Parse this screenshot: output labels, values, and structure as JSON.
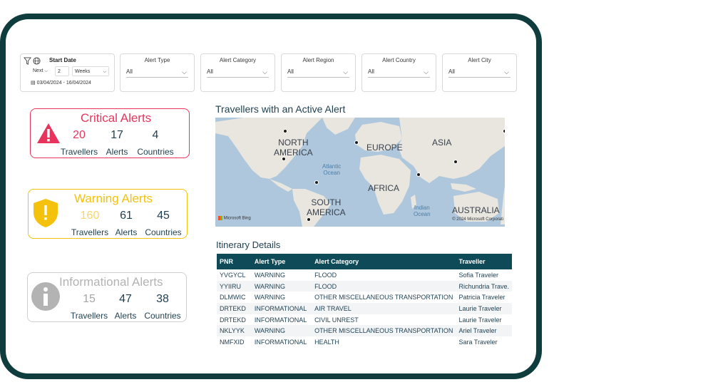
{
  "filters": {
    "start_date": {
      "title": "Start Date",
      "period": "Next",
      "count": "2",
      "unit": "Weeks",
      "range": "03/04/2024 - 16/04/2024"
    },
    "items": [
      {
        "title": "Alert Type",
        "value": "All"
      },
      {
        "title": "Alert Category",
        "value": "All"
      },
      {
        "title": "Alert Region",
        "value": "All"
      },
      {
        "title": "Alert Country",
        "value": "All"
      },
      {
        "title": "Alert City",
        "value": "All"
      }
    ]
  },
  "critical": {
    "title": "Critical Alerts",
    "travellers": "20",
    "alerts": "17",
    "countries": "4",
    "color": "#e8345c"
  },
  "warning": {
    "title": "Warning Alerts",
    "travellers": "160",
    "alerts": "61",
    "countries": "45",
    "color": "#f4c20d"
  },
  "informational": {
    "title": "Informational Alerts",
    "travellers": "15",
    "alerts": "47",
    "countries": "38",
    "color": "#b3b3b3"
  },
  "labels": {
    "travellers": "Travellers",
    "alerts": "Alerts",
    "countries": "Countries"
  },
  "map": {
    "title": "Travellers with an Active Alert",
    "regions": {
      "north_america_1": "NORTH",
      "north_america_2": "AMERICA",
      "europe": "EUROPE",
      "asia": "ASIA",
      "africa": "AFRICA",
      "south_america_1": "SOUTH",
      "south_america_2": "AMERICA",
      "australia": "AUSTRALIA"
    },
    "oceans": {
      "atlantic_1": "Atlantic",
      "atlantic_2": "Ocean",
      "indian_1": "Indian",
      "indian_2": "Ocean"
    },
    "attribution_left": "Microsoft Bing",
    "attribution_right": "© 2024 Microsoft Corporati"
  },
  "itinerary": {
    "title": "Itinerary Details",
    "columns": [
      "PNR",
      "Alert Type",
      "Alert Category",
      "Traveller"
    ],
    "rows": [
      [
        "YVGYCL",
        "WARNING",
        "FLOOD",
        "Sofia Traveler"
      ],
      [
        "YYIIRU",
        "WARNING",
        "FLOOD",
        "Richundria Trave."
      ],
      [
        "DLMWIC",
        "WARNING",
        "OTHER MISCELLANEOUS TRANSPORTATION",
        "Patricia Traveler"
      ],
      [
        "DRTEKD",
        "INFORMATIONAL",
        "AIR TRAVEL",
        "Laurie Traveler"
      ],
      [
        "DRTEKD",
        "INFORMATIONAL",
        "CIVIL UNREST",
        "Laurie Traveler"
      ],
      [
        "NKLYYK",
        "WARNING",
        "OTHER MISCELLANEOUS TRANSPORTATION",
        "Ariel Traveler"
      ],
      [
        "NMFXID",
        "INFORMATIONAL",
        "HEALTH",
        "Sara Traveler"
      ]
    ]
  },
  "icons": {
    "filter": "filter-icon",
    "globe": "globe-icon",
    "calendar": "calendar-icon",
    "critical": "warning-triangle-icon",
    "warning": "shield-exclamation-icon",
    "info": "info-circle-icon"
  }
}
